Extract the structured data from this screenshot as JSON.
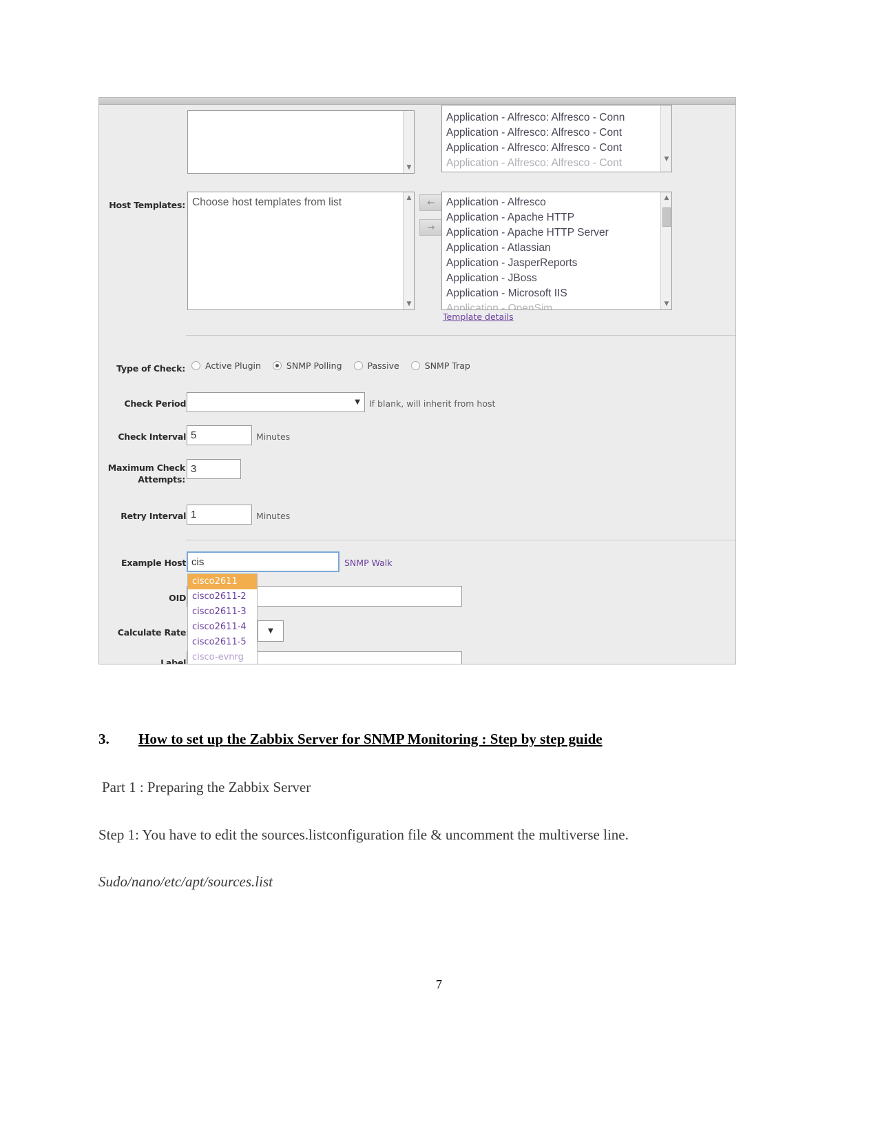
{
  "document": {
    "heading": {
      "number": "3.",
      "title": "How to set up the Zabbix Server for SNMP Monitoring : Step by step guide"
    },
    "paragraphs": [
      {
        "text": "Part 1 : Preparing the Zabbix Server",
        "style": "normal"
      },
      {
        "text": "Step 1: You have to edit the sources.listconfiguration file & uncomment the multiverse line.",
        "style": "normal"
      },
      {
        "text": "Sudo/nano/etc/apt/sources.list",
        "style": "italic"
      }
    ],
    "page_number": "7"
  },
  "screenshot": {
    "top_partial": {
      "selected_list_items": [
        "Application - Alfresco: Alfresco - Conn",
        "Application - Alfresco: Alfresco - Cont",
        "Application - Alfresco: Alfresco - Cont",
        "Application - Alfresco: Alfresco - Cont"
      ]
    },
    "host_templates": {
      "label": "Host Templates:",
      "chosen_placeholder": "Choose host templates from list",
      "available_items": [
        "Application - Alfresco",
        "Application - Apache HTTP",
        "Application - Apache HTTP Server",
        "Application - Atlassian",
        "Application - JasperReports",
        "Application - JBoss",
        "Application - Microsoft IIS",
        "Application - OpenSim"
      ],
      "template_details_link": "Template details",
      "add_arrow": "←",
      "remove_arrow": "→"
    },
    "type_of_check": {
      "label": "Type of Check:",
      "options": [
        {
          "label": "Active Plugin",
          "selected": false
        },
        {
          "label": "SNMP Polling",
          "selected": true
        },
        {
          "label": "Passive",
          "selected": false
        },
        {
          "label": "SNMP Trap",
          "selected": false
        }
      ]
    },
    "check_period": {
      "label": "Check Period:",
      "value": "",
      "hint": "If blank, will inherit from host"
    },
    "check_interval": {
      "label": "Check Interval:",
      "value": "5",
      "unit": "Minutes"
    },
    "max_check_attempts": {
      "label": "Maximum Check Attempts:",
      "label_line1": "Maximum Check",
      "label_line2": "Attempts:",
      "value": "3"
    },
    "retry_interval": {
      "label": "Retry Interval:",
      "value": "1",
      "unit": "Minutes"
    },
    "example_host": {
      "label": "Example Host:",
      "value": "cis",
      "action_link": "SNMP Walk",
      "suggestions": [
        {
          "text": "cisco2611",
          "selected": true
        },
        {
          "text": "cisco2611-2",
          "selected": false
        },
        {
          "text": "cisco2611-3",
          "selected": false
        },
        {
          "text": "cisco2611-4",
          "selected": false
        },
        {
          "text": "cisco2611-5",
          "selected": false
        },
        {
          "text": "cisco-evnrg",
          "selected": false
        }
      ]
    },
    "oid": {
      "label": "OID:",
      "value": ""
    },
    "calculate_rate": {
      "label": "Calculate Rate:",
      "value": ""
    },
    "label_field": {
      "label": "Label:",
      "value": ""
    },
    "colors": {
      "highlight": "#f2ad4d",
      "link": "#6b3fa0",
      "focus_border": "#7ba7d7",
      "panel_bg": "#ececec"
    }
  }
}
